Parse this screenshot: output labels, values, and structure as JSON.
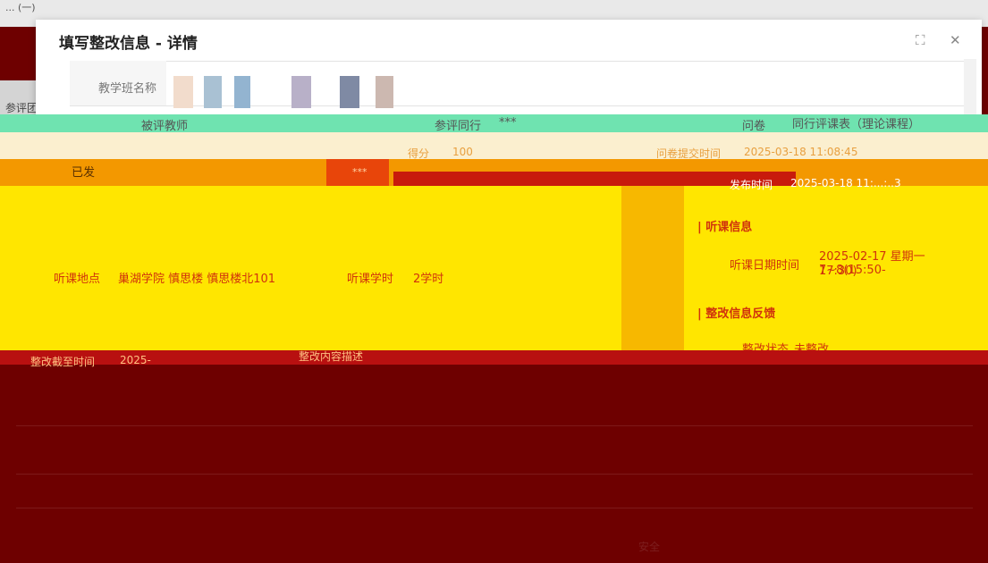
{
  "background": {
    "top_text": "... (一)",
    "strip_label": "参评团"
  },
  "modal": {
    "title": "填写整改信息 - 详情",
    "fullscreen_icon": "expand-icon",
    "close_icon": "close-icon",
    "rows": {
      "class_name_label": "教学班名称",
      "evaluated_teacher_label": "被评教师",
      "peer_label": "参评同行",
      "peer_value": "***",
      "questionnaire_label": "问卷",
      "questionnaire_value": "同行评课表（理论课程）",
      "score_label": "得分",
      "score_value": "100",
      "submit_time_label": "问卷提交时间",
      "submit_time_value": "2025-03-18 11:08:45",
      "status_value": "已发",
      "masked_value": "***",
      "issue_time_label": "发布时间",
      "issue_time_value": "2025-03-18 11:...:..3"
    },
    "sections": {
      "lecture_info_title": "听课信息",
      "lecture_datetime_label": "听课日期时间",
      "lecture_datetime_value_1": "2025-02-17 星期一 7~8(15:50-",
      "lecture_datetime_value_2": "17:30)",
      "lecture_location_label": "听课地点",
      "lecture_location_value": "巢湖学院 慎思楼 慎思楼北101",
      "lecture_hours_label": "听课学时",
      "lecture_hours_value": "2学时",
      "rectification_title": "整改信息反馈",
      "rectification_status_label": "整改状态",
      "rectification_status_value": "未整改",
      "deadline_label": "整改截至时间",
      "deadline_value": "2025-",
      "content_label": "整改内容描述"
    }
  },
  "bottom": {
    "trailing_label": "安全"
  },
  "colors": {
    "yellow": "#ffe600",
    "orange": "#f39800",
    "red": "#c81a0c",
    "dark_red": "#6e0000",
    "text_red": "#d0330c"
  }
}
